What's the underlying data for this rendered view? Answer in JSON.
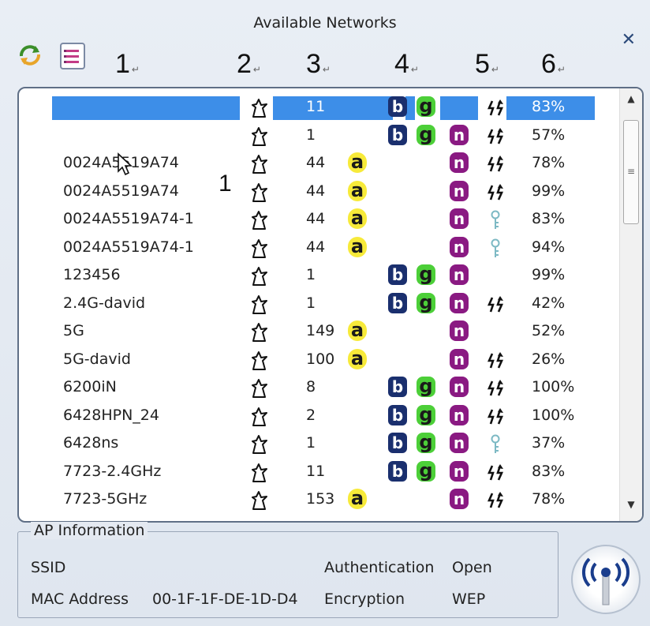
{
  "window": {
    "title": "Available Networks",
    "close_label": "✕"
  },
  "toolbar": {
    "refresh_icon": "refresh-icon",
    "list_icon": "list-view-icon"
  },
  "columns": [
    {
      "label": "1",
      "marker": "↵"
    },
    {
      "label": "2",
      "marker": "↵"
    },
    {
      "label": "3",
      "marker": "↵"
    },
    {
      "label": "4",
      "marker": "↵"
    },
    {
      "label": "5",
      "marker": "↵"
    },
    {
      "label": "6",
      "marker": "↵"
    }
  ],
  "overlay_label": "1",
  "networks": [
    {
      "ssid": "",
      "channel": "11",
      "a": false,
      "b": true,
      "g": true,
      "n": false,
      "security": "wps",
      "signal": "83%",
      "selected": true
    },
    {
      "ssid": "",
      "channel": "1",
      "a": false,
      "b": true,
      "g": true,
      "n": true,
      "security": "wps",
      "signal": "57%"
    },
    {
      "ssid": "0024A5519A74",
      "channel": "44",
      "a": true,
      "b": false,
      "g": false,
      "n": true,
      "security": "wps",
      "signal": "78%"
    },
    {
      "ssid": "0024A5519A74",
      "channel": "44",
      "a": true,
      "b": false,
      "g": false,
      "n": true,
      "security": "wps",
      "signal": "99%"
    },
    {
      "ssid": "0024A5519A74-1",
      "channel": "44",
      "a": true,
      "b": false,
      "g": false,
      "n": true,
      "security": "key",
      "signal": "83%"
    },
    {
      "ssid": "0024A5519A74-1",
      "channel": "44",
      "a": true,
      "b": false,
      "g": false,
      "n": true,
      "security": "key",
      "signal": "94%"
    },
    {
      "ssid": "123456",
      "channel": "1",
      "a": false,
      "b": true,
      "g": true,
      "n": true,
      "security": "",
      "signal": "99%"
    },
    {
      "ssid": "2.4G-david",
      "channel": "1",
      "a": false,
      "b": true,
      "g": true,
      "n": true,
      "security": "wps",
      "signal": "42%"
    },
    {
      "ssid": "5G",
      "channel": "149",
      "a": true,
      "b": false,
      "g": false,
      "n": true,
      "security": "",
      "signal": "52%"
    },
    {
      "ssid": "5G-david",
      "channel": "100",
      "a": true,
      "b": false,
      "g": false,
      "n": true,
      "security": "wps",
      "signal": "26%"
    },
    {
      "ssid": "6200iN",
      "channel": "8",
      "a": false,
      "b": true,
      "g": true,
      "n": true,
      "security": "wps",
      "signal": "100%"
    },
    {
      "ssid": "6428HPN_24",
      "channel": "2",
      "a": false,
      "b": true,
      "g": true,
      "n": true,
      "security": "wps",
      "signal": "100%"
    },
    {
      "ssid": "6428ns",
      "channel": "1",
      "a": false,
      "b": true,
      "g": true,
      "n": true,
      "security": "key",
      "signal": "37%"
    },
    {
      "ssid": "7723-2.4GHz",
      "channel": "11",
      "a": false,
      "b": true,
      "g": true,
      "n": true,
      "security": "wps",
      "signal": "83%"
    },
    {
      "ssid": "7723-5GHz",
      "channel": "153",
      "a": true,
      "b": false,
      "g": false,
      "n": true,
      "security": "wps",
      "signal": "78%"
    }
  ],
  "badges": {
    "a": "a",
    "b": "b",
    "g": "g",
    "n": "n"
  },
  "scrollbar": {
    "up": "▲",
    "down": "▼",
    "grip": "≡"
  },
  "ap_info": {
    "legend": "AP Information",
    "ssid_label": "SSID",
    "mac_label": "MAC Address",
    "mac_value": "00-1F-1F-DE-1D-D4",
    "auth_label": "Authentication",
    "auth_value": "Open",
    "enc_label": "Encryption",
    "enc_value": "WEP"
  }
}
